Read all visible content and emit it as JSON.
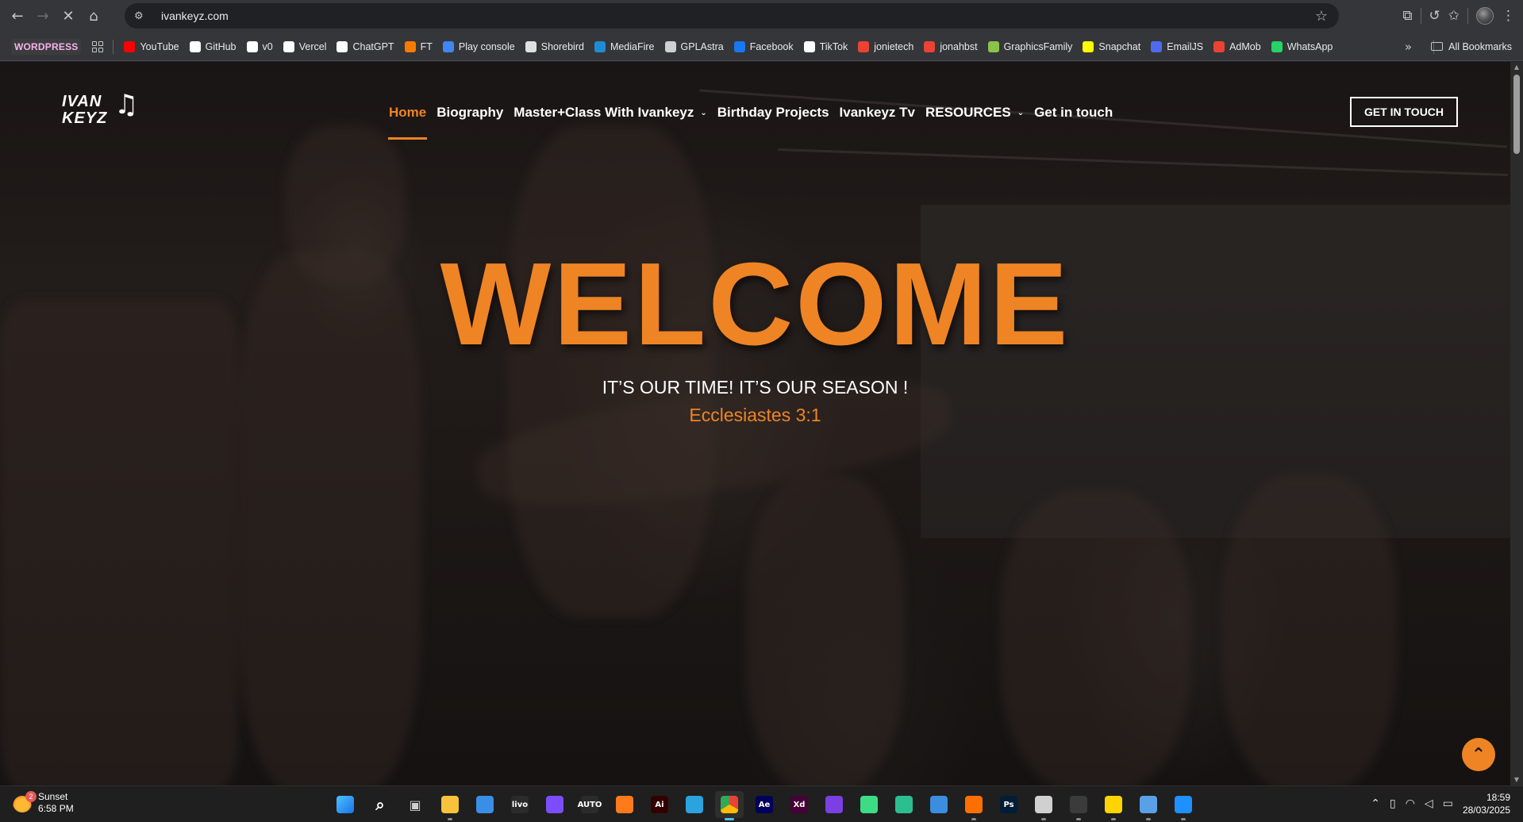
{
  "browser": {
    "url": "ivankeyz.com",
    "bookmarks": [
      {
        "label": "WORDPRESS",
        "icon": "wordpress-badge",
        "color": "#f7b3e8"
      },
      {
        "label": "YouTube",
        "icon": "youtube-icon",
        "color": "#ff0000"
      },
      {
        "label": "GitHub",
        "icon": "github-icon",
        "color": "#ffffff"
      },
      {
        "label": "v0",
        "icon": "v0-icon",
        "color": "#ffffff"
      },
      {
        "label": "Vercel",
        "icon": "vercel-icon",
        "color": "#ffffff"
      },
      {
        "label": "ChatGPT",
        "icon": "chatgpt-icon",
        "color": "#ffffff"
      },
      {
        "label": "FT",
        "icon": "ft-icon",
        "color": "#f57c00"
      },
      {
        "label": "Play console",
        "icon": "play-console-icon",
        "color": "#4285f4"
      },
      {
        "label": "Shorebird",
        "icon": "shorebird-icon",
        "color": "#e0e0e0"
      },
      {
        "label": "MediaFire",
        "icon": "mediafire-icon",
        "color": "#1f8bd6"
      },
      {
        "label": "GPLAstra",
        "icon": "gplastra-icon",
        "color": "#cfcfcf"
      },
      {
        "label": "Facebook",
        "icon": "facebook-icon",
        "color": "#1877f2"
      },
      {
        "label": "TikTok",
        "icon": "tiktok-icon",
        "color": "#ffffff"
      },
      {
        "label": "jonietech",
        "icon": "gmail-icon",
        "color": "#ea4335"
      },
      {
        "label": "jonahbst",
        "icon": "gmail-icon",
        "color": "#ea4335"
      },
      {
        "label": "GraphicsFamily",
        "icon": "graphicsfamily-icon",
        "color": "#8bc34a"
      },
      {
        "label": "Snapchat",
        "icon": "snapchat-icon",
        "color": "#fffc00"
      },
      {
        "label": "EmailJS",
        "icon": "emailjs-icon",
        "color": "#4f6bed"
      },
      {
        "label": "AdMob",
        "icon": "admob-icon",
        "color": "#ea4335"
      },
      {
        "label": "WhatsApp",
        "icon": "whatsapp-icon",
        "color": "#25d366"
      }
    ],
    "all_bookmarks_label": "All Bookmarks"
  },
  "site": {
    "logo_line1": "IVAN",
    "logo_line2": "KEYZ",
    "nav": [
      {
        "label": "Home",
        "active": true,
        "dropdown": false
      },
      {
        "label": "Biography",
        "active": false,
        "dropdown": false
      },
      {
        "label": "Master+Class With Ivankeyz",
        "active": false,
        "dropdown": true
      },
      {
        "label": "Birthday Projects",
        "active": false,
        "dropdown": false
      },
      {
        "label": "Ivankeyz Tv",
        "active": false,
        "dropdown": false
      },
      {
        "label": "RESOURCES",
        "active": false,
        "dropdown": true
      },
      {
        "label": "Get in touch",
        "active": false,
        "dropdown": false
      }
    ],
    "cta_label": "GET IN TOUCH",
    "accent_color": "#ef8424"
  },
  "hero": {
    "title": "WELCOME",
    "subtitle": "IT’S OUR TIME! IT’S OUR SEASON !",
    "reference": "Ecclesiastes 3:1"
  },
  "taskbar": {
    "weather_label": "Sunset",
    "weather_time": "6:58 PM",
    "notification_count": "2",
    "apps": [
      {
        "name": "windows-start-icon",
        "label": "",
        "color": "#4cc2ff"
      },
      {
        "name": "search-icon",
        "label": "",
        "color": "#ffffff"
      },
      {
        "name": "task-view-icon",
        "label": "",
        "color": "#cfcfcf"
      },
      {
        "name": "file-explorer-icon",
        "label": "",
        "color": "#f8c33a"
      },
      {
        "name": "microsoft-store-icon",
        "label": "",
        "color": "#3a8ee6"
      },
      {
        "name": "livo-icon",
        "label": "livo",
        "color": "#2b2b2b"
      },
      {
        "name": "app-launcher-icon",
        "label": "",
        "color": "#7c4dff"
      },
      {
        "name": "auto-icon",
        "label": "AUTO",
        "color": "#2b2b2b"
      },
      {
        "name": "magnifier-app-icon",
        "label": "",
        "color": "#ff7a1a"
      },
      {
        "name": "illustrator-icon",
        "label": "Ai",
        "color": "#330000"
      },
      {
        "name": "telegram-icon",
        "label": "",
        "color": "#2aa3df"
      },
      {
        "name": "chrome-icon",
        "label": "",
        "color": "#4caf50"
      },
      {
        "name": "after-effects-icon",
        "label": "Ae",
        "color": "#00005b"
      },
      {
        "name": "adobe-xd-icon",
        "label": "Xd",
        "color": "#470137"
      },
      {
        "name": "github-desktop-icon",
        "label": "",
        "color": "#7b3fe4"
      },
      {
        "name": "android-studio-icon",
        "label": "",
        "color": "#3ddc84"
      },
      {
        "name": "dev-tool-icon",
        "label": "",
        "color": "#2bbf8f"
      },
      {
        "name": "vmware-icon",
        "label": "",
        "color": "#3c8dde"
      },
      {
        "name": "orange-app-icon",
        "label": "",
        "color": "#ff6f00"
      },
      {
        "name": "photoshop-icon",
        "label": "Ps",
        "color": "#001e36"
      },
      {
        "name": "unity-icon",
        "label": "",
        "color": "#d0d0d0"
      },
      {
        "name": "terminal-icon",
        "label": "",
        "color": "#3b3b3b"
      },
      {
        "name": "sticky-notes-icon",
        "label": "",
        "color": "#ffd400"
      },
      {
        "name": "remote-desktop-icon",
        "label": "",
        "color": "#5aa0e6"
      },
      {
        "name": "vscode-icon",
        "label": "",
        "color": "#1e90ff"
      }
    ],
    "time": "18:59",
    "date": "28/03/2025"
  }
}
